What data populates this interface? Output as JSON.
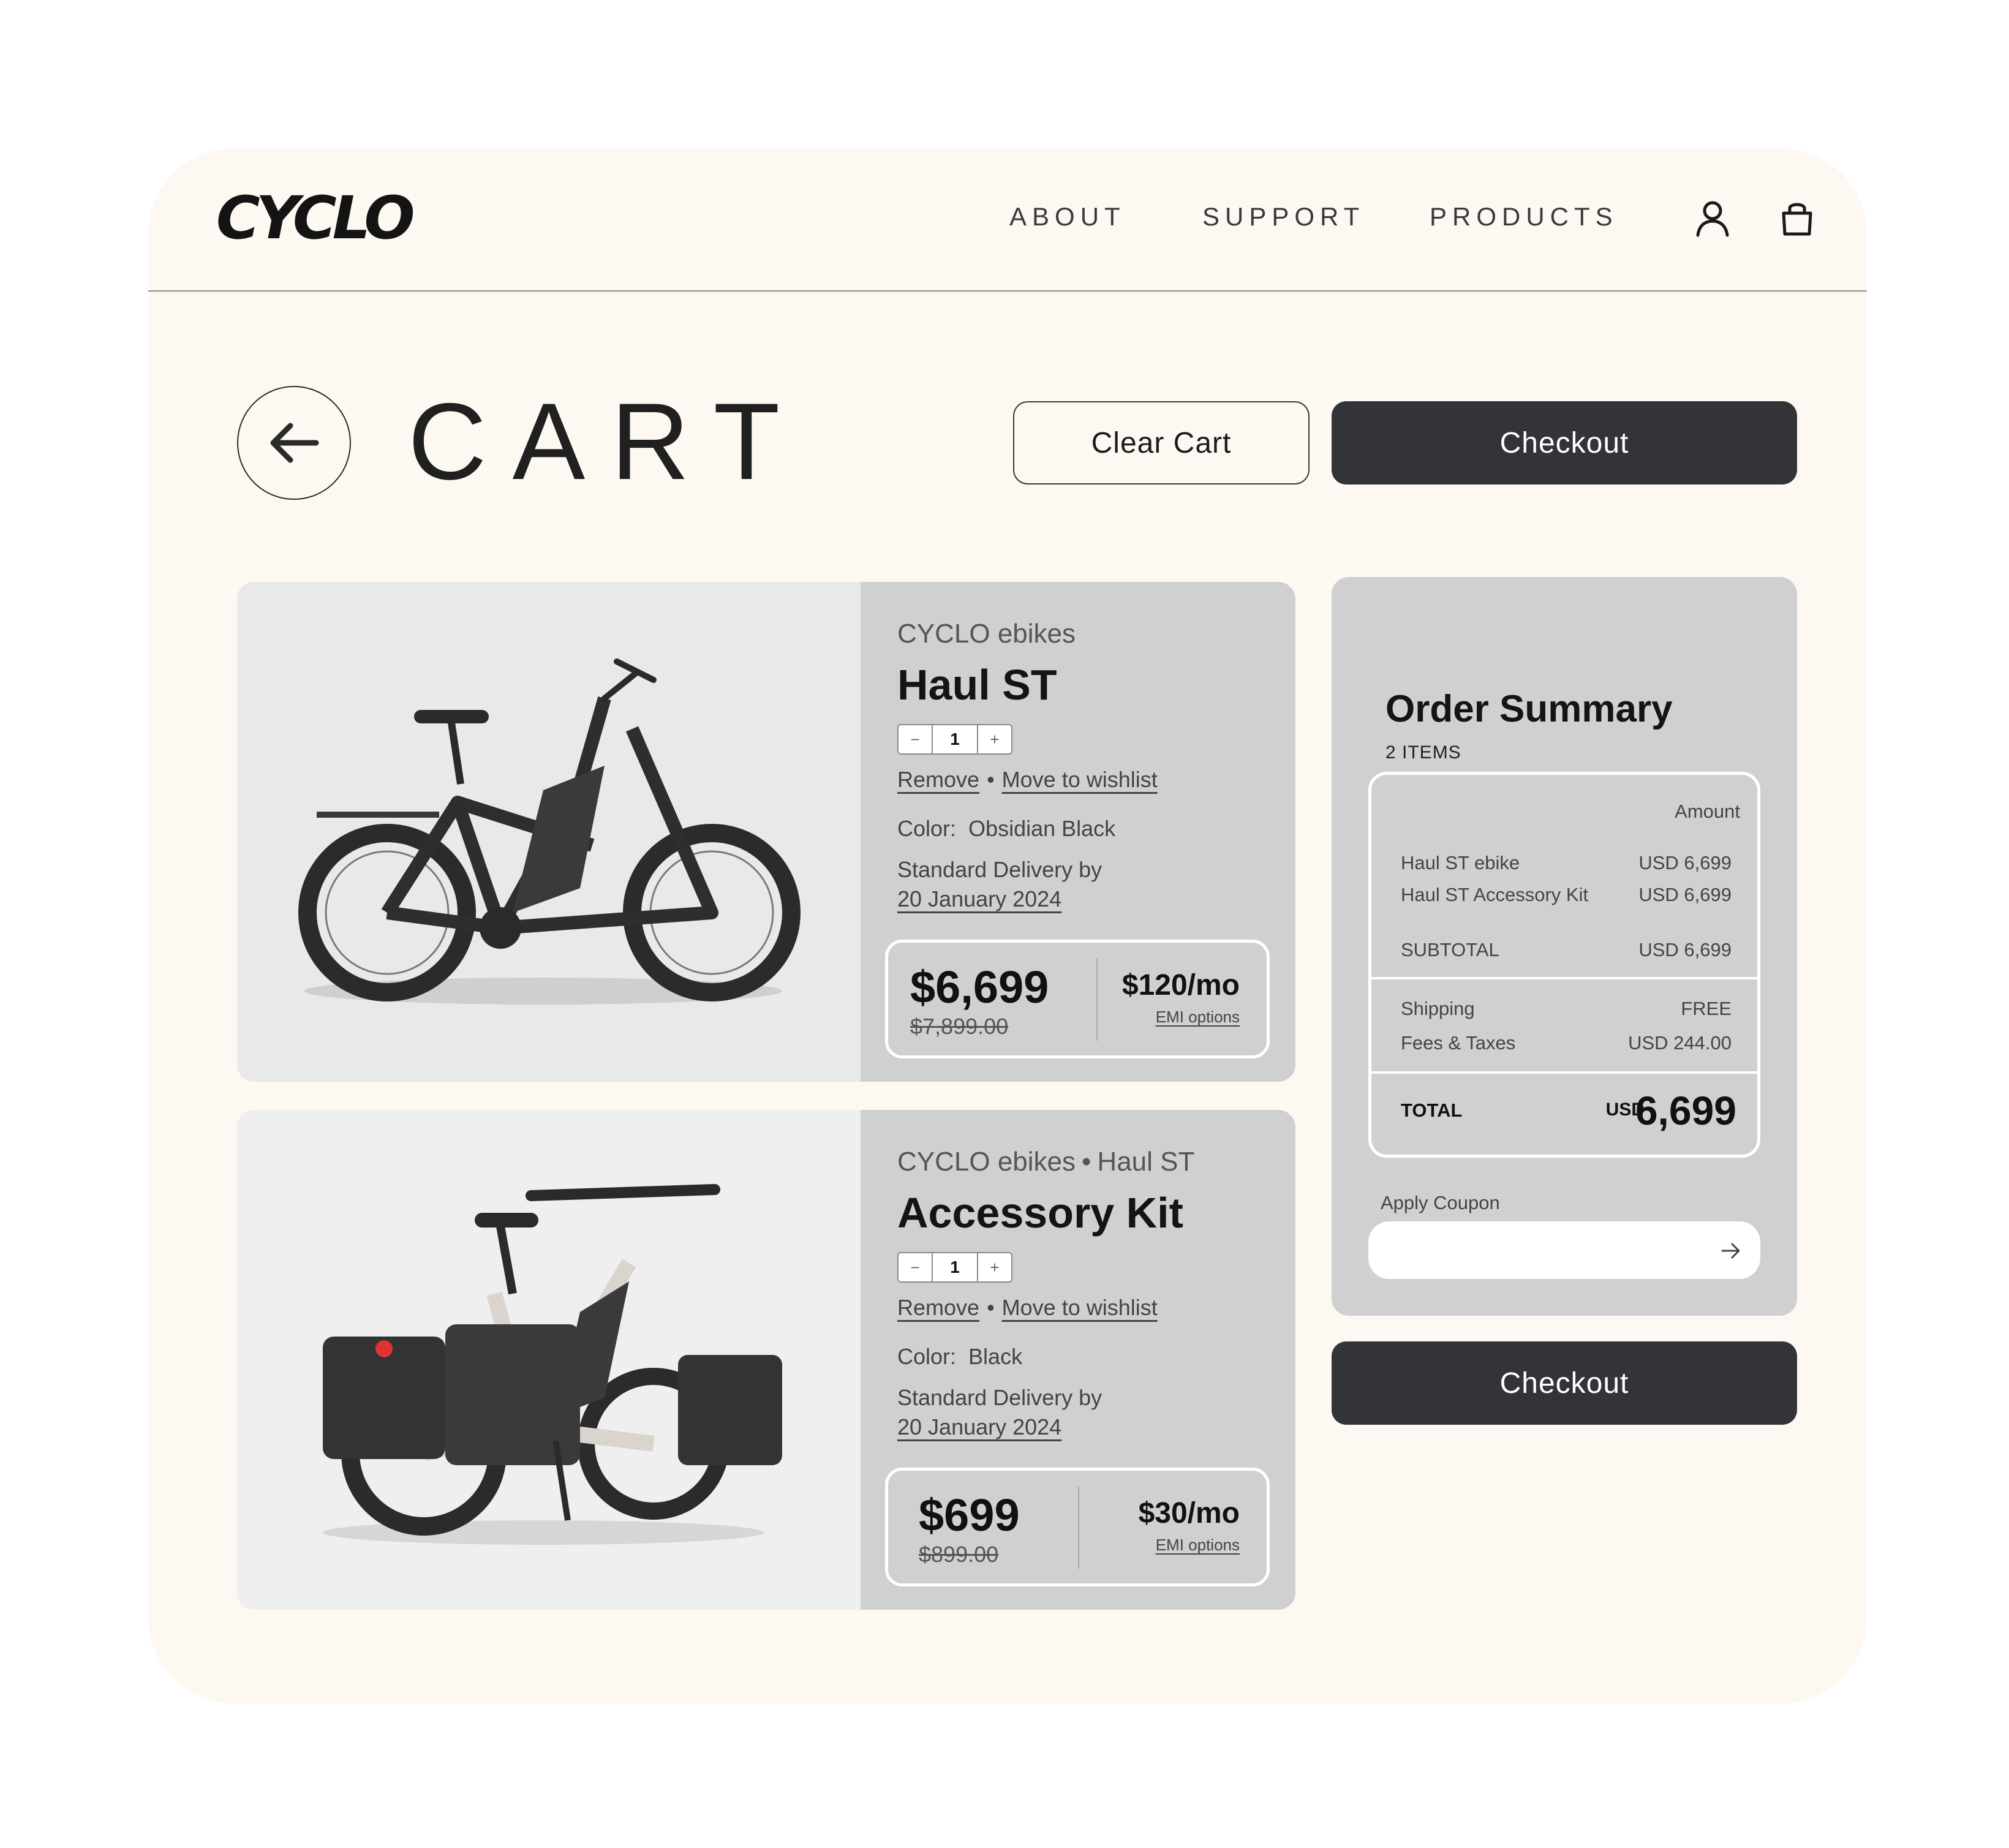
{
  "brand": {
    "logo": "CYCLO"
  },
  "nav": {
    "about": "ABOUT",
    "support": "SUPPORT",
    "products": "PRODUCTS"
  },
  "icons": {
    "account": "user-icon",
    "cart": "shopping-bag-icon",
    "back": "arrow-left-icon",
    "apply": "arrow-right-icon"
  },
  "page": {
    "title": "CART"
  },
  "actions": {
    "clear_cart": "Clear Cart",
    "checkout": "Checkout"
  },
  "cart_items": [
    {
      "brand": "CYCLO ebikes",
      "series": "",
      "name": "Haul ST",
      "quantity": "1",
      "qty_minus": "−",
      "qty_plus": "+",
      "remove": "Remove",
      "separator": "•",
      "wishlist": "Move to wishlist",
      "color_label": "Color:",
      "color_value": "Obsidian Black",
      "delivery_label": "Standard Delivery by",
      "delivery_date": "20 January 2024",
      "price": "$6,699",
      "original_price": "$7,899.00",
      "monthly": "$120/mo",
      "emi": "EMI options"
    },
    {
      "brand": "CYCLO ebikes",
      "series": "Haul ST",
      "name": "Accessory Kit",
      "quantity": "1",
      "qty_minus": "−",
      "qty_plus": "+",
      "remove": "Remove",
      "separator": "•",
      "wishlist": "Move to wishlist",
      "color_label": "Color:",
      "color_value": "Black",
      "delivery_label": "Standard Delivery by",
      "delivery_date": "20 January 2024",
      "price": "$699",
      "original_price": "$899.00",
      "monthly": "$30/mo",
      "emi": "EMI options"
    }
  ],
  "summary": {
    "title": "Order Summary",
    "count": "2 ITEMS",
    "amount_header": "Amount",
    "lines": [
      {
        "label": "Haul ST ebike",
        "value": "USD 6,699"
      },
      {
        "label": "Haul ST Accessory Kit",
        "value": "USD 6,699"
      }
    ],
    "subtotal": {
      "label": "SUBTOTAL",
      "value": "USD 6,699"
    },
    "shipping": {
      "label": "Shipping",
      "value": "FREE"
    },
    "fees": {
      "label": "Fees & Taxes",
      "value": "USD 244.00"
    },
    "total": {
      "label": "TOTAL",
      "currency": "USD",
      "value": "6,699"
    },
    "coupon_label": "Apply Coupon",
    "coupon_value": "",
    "coupon_placeholder": ""
  },
  "colors": {
    "page": "#fdf9f2",
    "card": "#d0d0d0",
    "dark_button": "#333437",
    "text": "#1e1e1e"
  }
}
